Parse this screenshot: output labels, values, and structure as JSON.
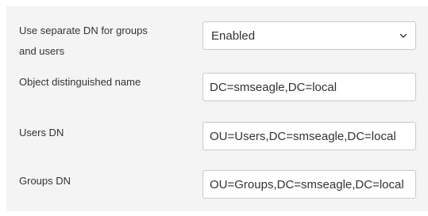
{
  "form": {
    "separate_dn": {
      "label_line1": "Use separate DN for groups",
      "label_line2": "and users",
      "value": "Enabled"
    },
    "object_dn": {
      "label": "Object distinguished name",
      "value": "DC=smseagle,DC=local"
    },
    "users_dn": {
      "label": "Users DN",
      "value": "OU=Users,DC=smseagle,DC=local"
    },
    "groups_dn": {
      "label": "Groups DN",
      "value": "OU=Groups,DC=smseagle,DC=local"
    }
  },
  "icons": {
    "select_chevron": "chevron-down-icon"
  },
  "colors": {
    "panel_background": "#f4f4f4",
    "field_border": "#c8c8c8",
    "text": "#333333"
  }
}
